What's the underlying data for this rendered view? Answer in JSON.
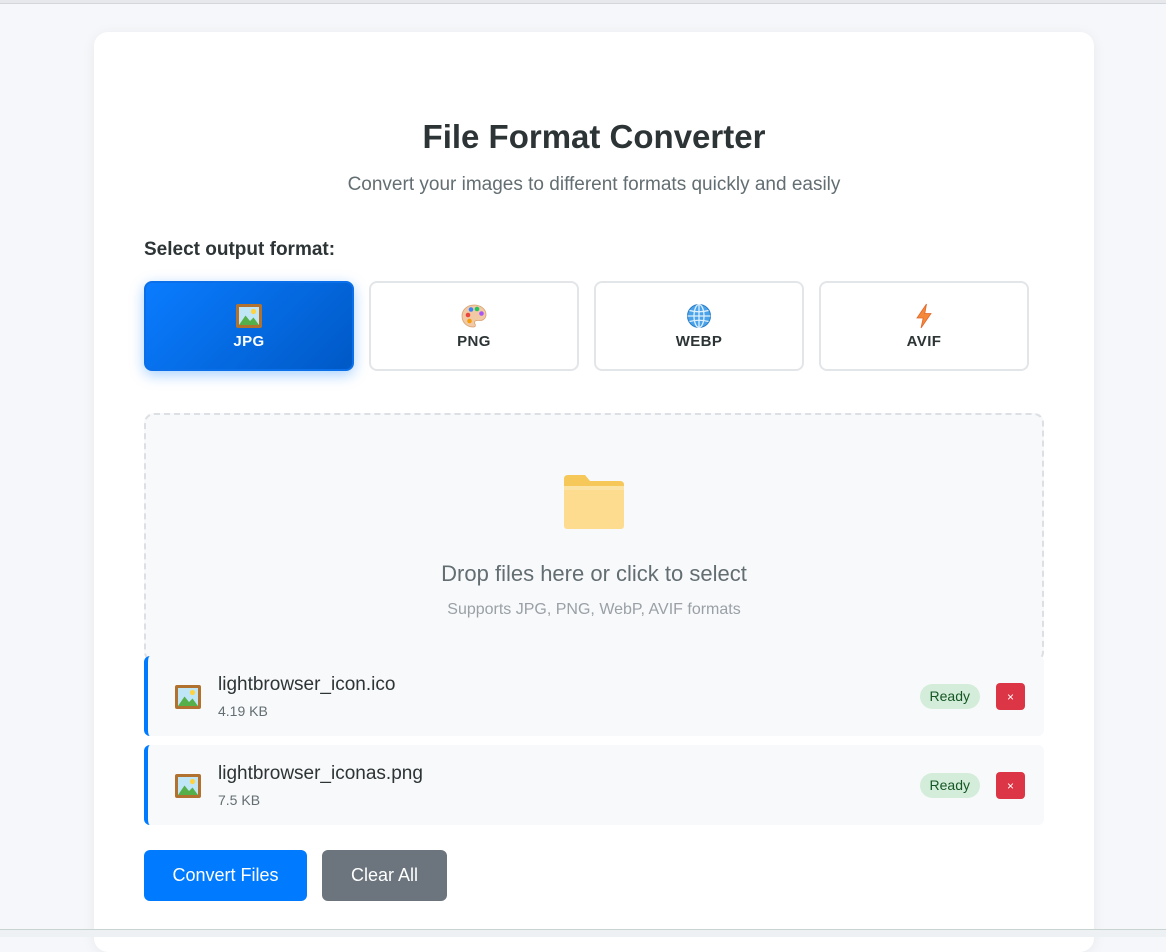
{
  "header": {
    "title": "File Format Converter",
    "subtitle": "Convert your images to different formats quickly and easily"
  },
  "format_selector": {
    "label": "Select output format:",
    "selected": "JPG",
    "options": [
      {
        "label": "JPG",
        "icon": "framed-picture-icon"
      },
      {
        "label": "PNG",
        "icon": "palette-icon"
      },
      {
        "label": "WEBP",
        "icon": "globe-icon"
      },
      {
        "label": "AVIF",
        "icon": "lightning-icon"
      }
    ]
  },
  "dropzone": {
    "icon": "folder-icon",
    "title": "Drop files here or click to select",
    "subtitle": "Supports JPG, PNG, WebP, AVIF formats"
  },
  "files": [
    {
      "name": "lightbrowser_icon.ico",
      "size": "4.19 KB",
      "status": "Ready",
      "remove_label": "×"
    },
    {
      "name": "lightbrowser_iconas.png",
      "size": "7.5 KB",
      "status": "Ready",
      "remove_label": "×"
    }
  ],
  "actions": {
    "convert_label": "Convert Files",
    "clear_label": "Clear All"
  },
  "colors": {
    "primary": "#007bff",
    "danger": "#dc3545",
    "secondary": "#6c757d",
    "ready_bg": "#d4edda",
    "ready_text": "#155724"
  }
}
